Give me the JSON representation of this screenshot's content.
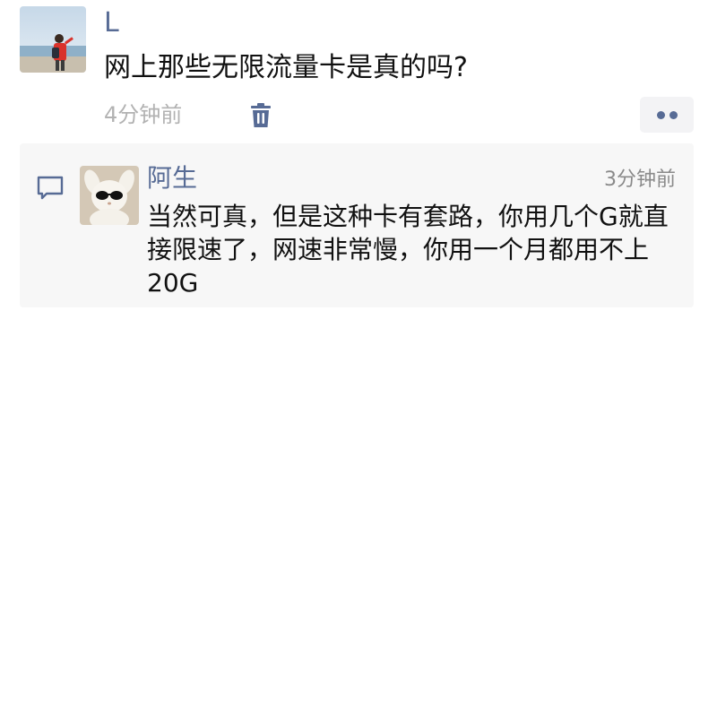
{
  "post": {
    "author": "L",
    "text": "网上那些无限流量卡是真的吗?",
    "time": "4分钟前",
    "avatar_icon": "person-at-seaside-photo",
    "delete_icon": "trash-icon",
    "more_icon": "more-dots-icon"
  },
  "comments": [
    {
      "author": "阿生",
      "time": "3分钟前",
      "text": "当然可真，但是这种卡有套路，你用几个G就直\n接限速了，网速非常慢，你用一个月都用不上\n20G",
      "avatar_icon": "bunny-with-sunglasses-avatar"
    }
  ],
  "colors": {
    "link": "#576b95",
    "time_gray": "#b2b2b2",
    "comment_bg": "#f7f7f7"
  }
}
